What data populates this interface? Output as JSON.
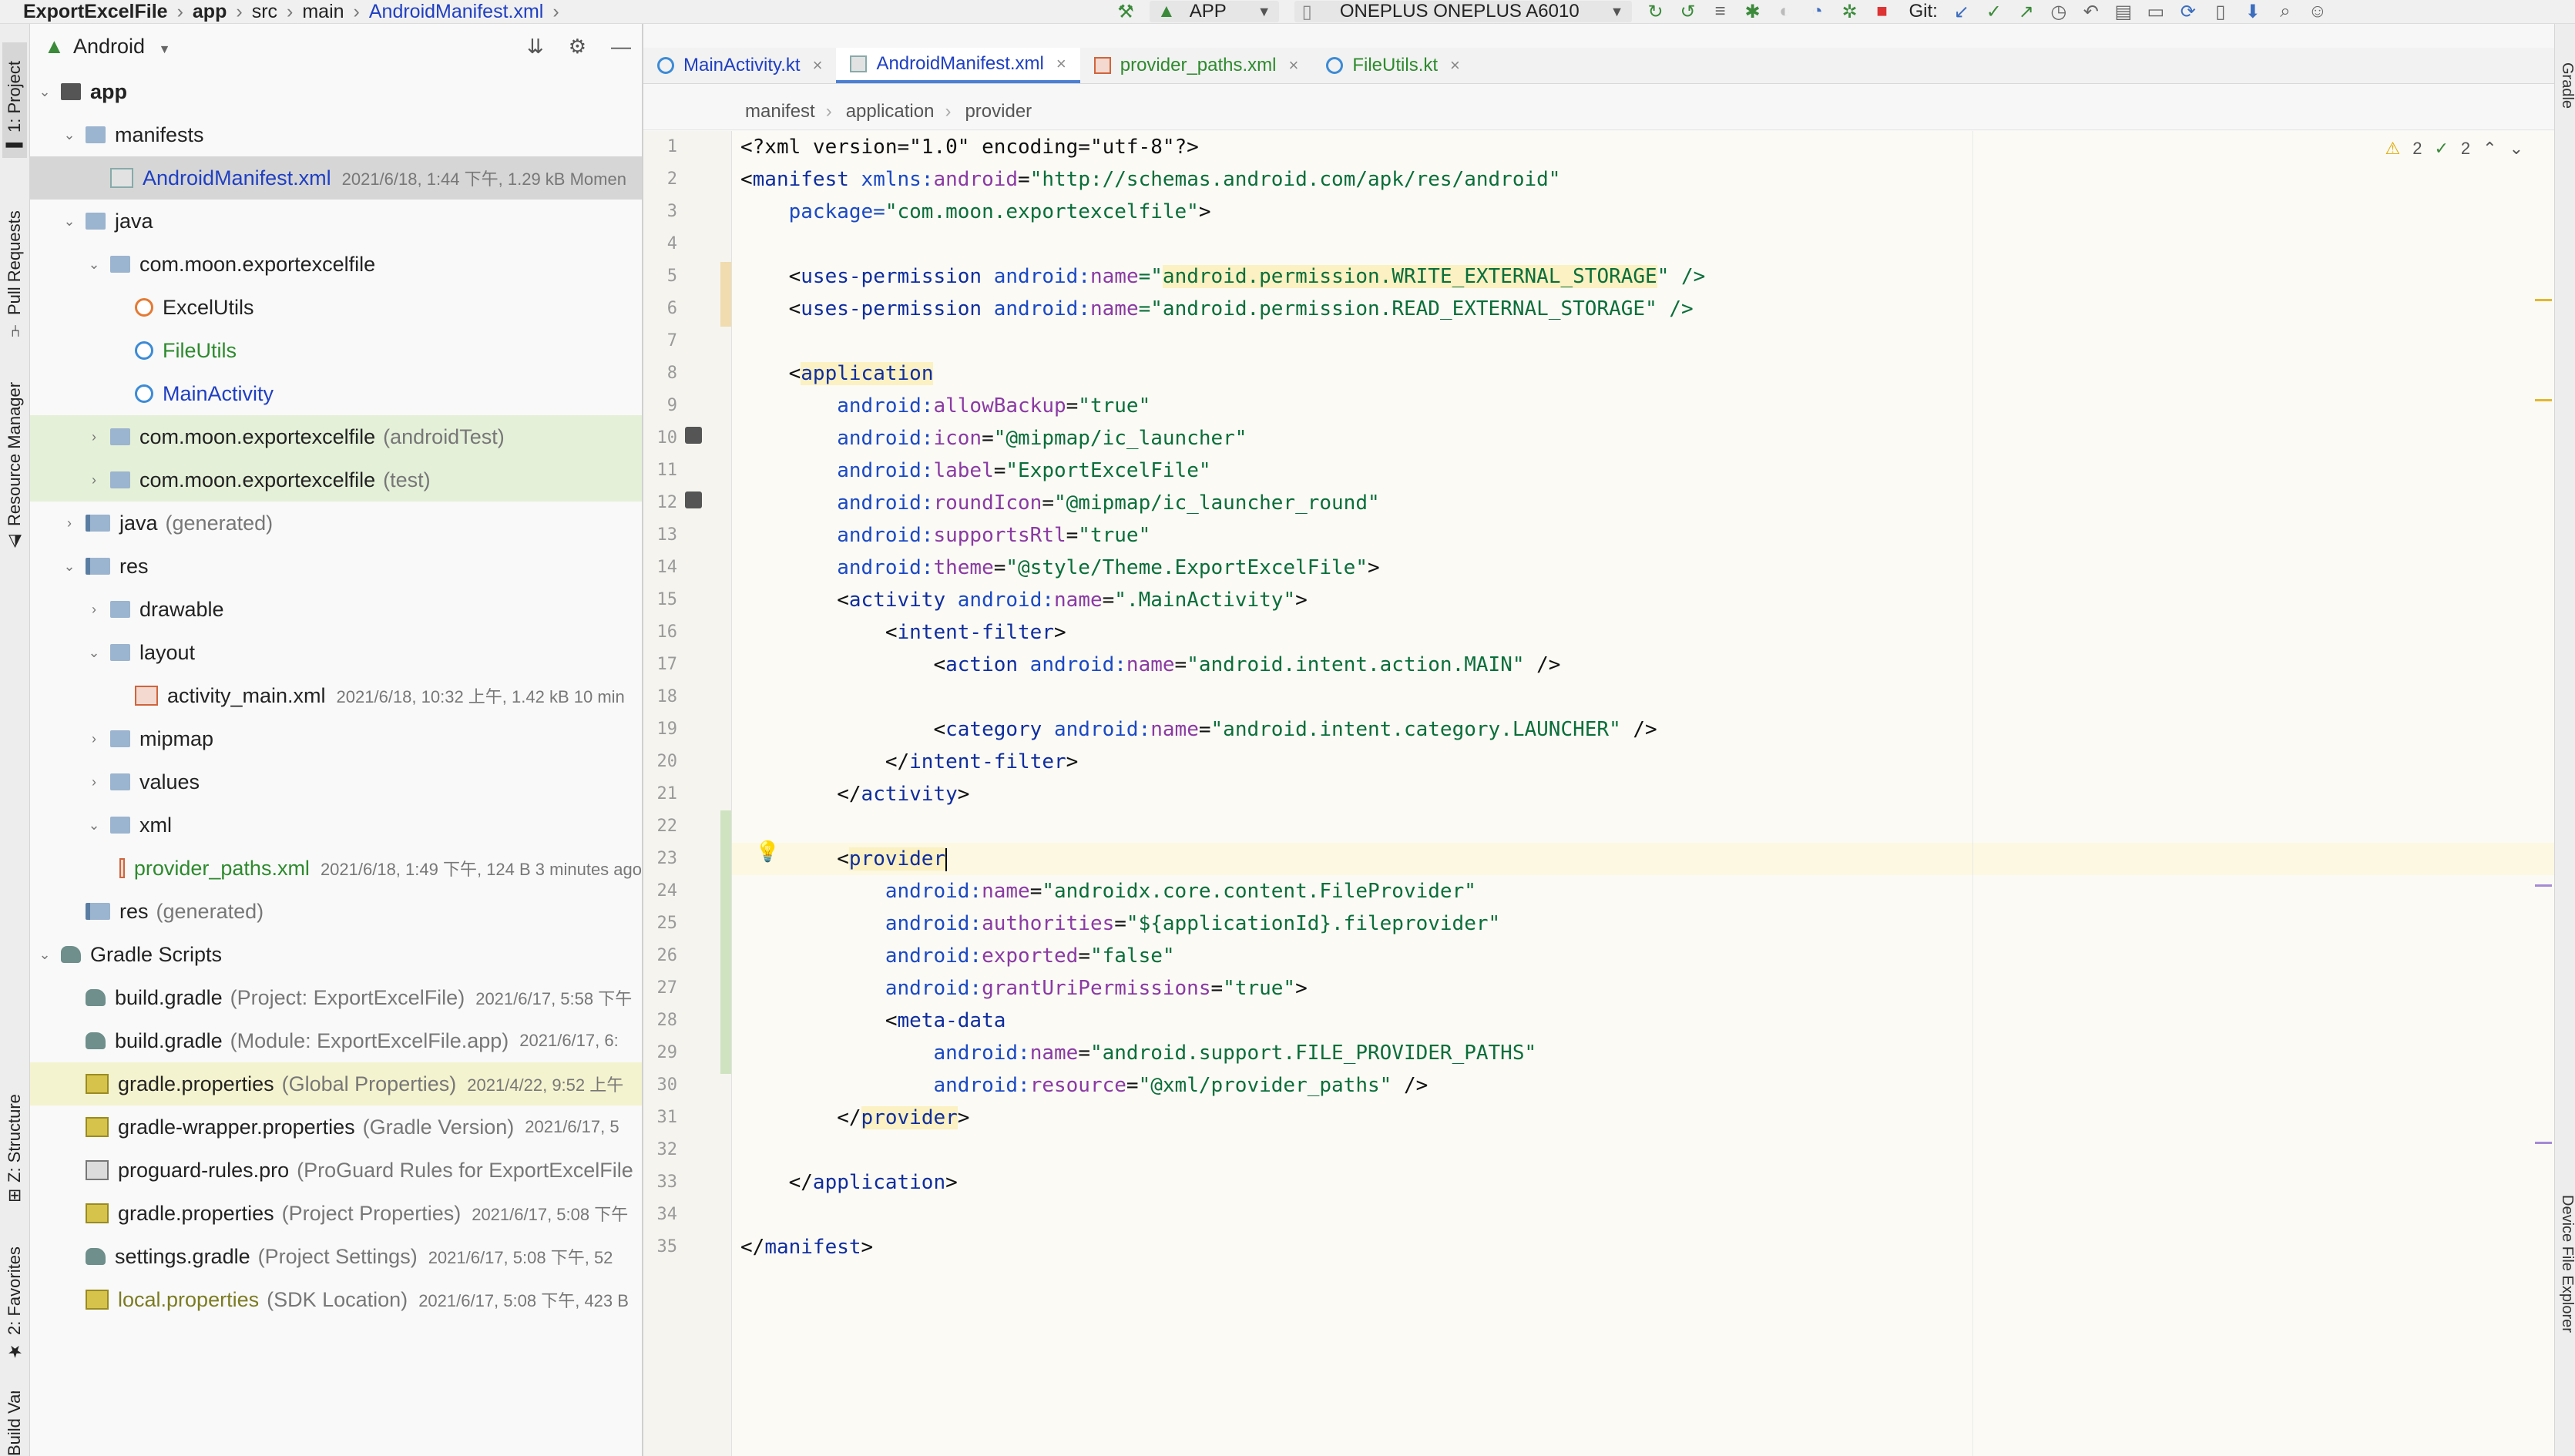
{
  "nav": {
    "breadcrumb": [
      "ExportExcelFile",
      "app",
      "src",
      "main",
      "AndroidManifest.xml"
    ],
    "run_config": "APP",
    "device": "ONEPLUS ONEPLUS A6010",
    "git_label": "Git:"
  },
  "left_tools": {
    "project": "1: Project",
    "pull_requests": "Pull Requests",
    "resource_manager": "Resource Manager",
    "structure": "Z: Structure",
    "favorites": "2: Favorites",
    "build_variants": "Build Variants"
  },
  "project_panel": {
    "view_mode": "Android",
    "tree": [
      {
        "label": "app",
        "bold": true
      },
      {
        "label": "manifests"
      },
      {
        "label": "AndroidManifest.xml",
        "meta": "2021/6/18, 1:44 下午, 1.29 kB Momen"
      },
      {
        "label": "java"
      },
      {
        "label": "com.moon.exportexcelfile"
      },
      {
        "label": "ExcelUtils"
      },
      {
        "label": "FileUtils"
      },
      {
        "label": "MainActivity"
      },
      {
        "label": "com.moon.exportexcelfile",
        "suffix": "(androidTest)"
      },
      {
        "label": "com.moon.exportexcelfile",
        "suffix": "(test)"
      },
      {
        "label": "java",
        "suffix": "(generated)"
      },
      {
        "label": "res"
      },
      {
        "label": "drawable"
      },
      {
        "label": "layout"
      },
      {
        "label": "activity_main.xml",
        "meta": "2021/6/18, 10:32 上午, 1.42 kB 10 min"
      },
      {
        "label": "mipmap"
      },
      {
        "label": "values"
      },
      {
        "label": "xml"
      },
      {
        "label": "provider_paths.xml",
        "meta": "2021/6/18, 1:49 下午, 124 B 3 minutes ago"
      },
      {
        "label": "res",
        "suffix": "(generated)"
      },
      {
        "label": "Gradle Scripts"
      },
      {
        "label": "build.gradle",
        "suffix": "(Project: ExportExcelFile)",
        "meta": "2021/6/17, 5:58 下午"
      },
      {
        "label": "build.gradle",
        "suffix": "(Module: ExportExcelFile.app)",
        "meta": "2021/6/17, 6:"
      },
      {
        "label": "gradle.properties",
        "suffix": "(Global Properties)",
        "meta": "2021/4/22, 9:52 上午"
      },
      {
        "label": "gradle-wrapper.properties",
        "suffix": "(Gradle Version)",
        "meta": "2021/6/17, 5"
      },
      {
        "label": "proguard-rules.pro",
        "suffix": "(ProGuard Rules for ExportExcelFile"
      },
      {
        "label": "gradle.properties",
        "suffix": "(Project Properties)",
        "meta": "2021/6/17, 5:08 下午"
      },
      {
        "label": "settings.gradle",
        "suffix": "(Project Settings)",
        "meta": "2021/6/17, 5:08 下午, 52"
      },
      {
        "label": "local.properties",
        "suffix": "(SDK Location)",
        "meta": "2021/6/17, 5:08 下午, 423 B"
      }
    ]
  },
  "editor": {
    "tabs": [
      "MainActivity.kt",
      "AndroidManifest.xml",
      "provider_paths.xml",
      "FileUtils.kt"
    ],
    "active_tab": "AndroidManifest.xml",
    "breadcrumb": [
      "manifest",
      "application",
      "provider"
    ],
    "inspection": {
      "warnings": "2",
      "ok": "2"
    },
    "line_numbers": [
      "1",
      "2",
      "3",
      "4",
      "5",
      "6",
      "7",
      "8",
      "9",
      "10",
      "11",
      "12",
      "13",
      "14",
      "15",
      "16",
      "17",
      "18",
      "19",
      "20",
      "21",
      "22",
      "23",
      "24",
      "25",
      "26",
      "27",
      "28",
      "29",
      "30",
      "31",
      "32",
      "33",
      "34",
      "35"
    ],
    "code": {
      "l1": {
        "a": "<?xml version=\"1.0\" encoding=\"utf-8\"?>"
      },
      "l2": {
        "a": "<",
        "b": "manifest",
        "c": " xmlns:",
        "d": "android",
        "e": "=",
        "f": "\"http://schemas.android.com/apk/res/android\""
      },
      "l3": {
        "a": "    package=",
        "b": "\"com.moon.exportexcelfile\"",
        "c": ">"
      },
      "l5": {
        "a": "    <",
        "b": "uses-permission",
        "c": " android:",
        "d": "name",
        "e": "=\"",
        "f": "android.permission.WRITE_EXTERNAL_STORAGE",
        "g": "\" />"
      },
      "l6": {
        "a": "    <",
        "b": "uses-permission",
        "c": " android:",
        "d": "name",
        "e": "=\"",
        "f": "android.permission.READ_EXTERNAL_STORAGE",
        "g": "\" />"
      },
      "l8": {
        "a": "    <",
        "b": "application"
      },
      "l9": {
        "a": "        android:",
        "b": "allowBackup",
        "c": "=",
        "d": "\"true\""
      },
      "l10": {
        "a": "        android:",
        "b": "icon",
        "c": "=",
        "d": "\"@mipmap/ic_launcher\""
      },
      "l11": {
        "a": "        android:",
        "b": "label",
        "c": "=",
        "d": "\"ExportExcelFile\""
      },
      "l12": {
        "a": "        android:",
        "b": "roundIcon",
        "c": "=",
        "d": "\"@mipmap/ic_launcher_round\""
      },
      "l13": {
        "a": "        android:",
        "b": "supportsRtl",
        "c": "=",
        "d": "\"true\""
      },
      "l14": {
        "a": "        android:",
        "b": "theme",
        "c": "=",
        "d": "\"@style/Theme.ExportExcelFile\"",
        "e": ">"
      },
      "l15": {
        "a": "        <",
        "b": "activity",
        "c": " android:",
        "d": "name",
        "e": "=",
        "f": "\".MainActivity\"",
        "g": ">"
      },
      "l16": {
        "a": "            <",
        "b": "intent-filter",
        "c": ">"
      },
      "l17": {
        "a": "                <",
        "b": "action",
        "c": " android:",
        "d": "name",
        "e": "=",
        "f": "\"android.intent.action.MAIN\"",
        "g": " />"
      },
      "l19": {
        "a": "                <",
        "b": "category",
        "c": " android:",
        "d": "name",
        "e": "=",
        "f": "\"android.intent.category.LAUNCHER\"",
        "g": " />"
      },
      "l20": {
        "a": "            </",
        "b": "intent-filter",
        "c": ">"
      },
      "l21": {
        "a": "        </",
        "b": "activity",
        "c": ">"
      },
      "l23": {
        "a": "        <",
        "b": "provider"
      },
      "l24": {
        "a": "            android:",
        "b": "name",
        "c": "=",
        "d": "\"androidx.core.content.FileProvider\""
      },
      "l25": {
        "a": "            android:",
        "b": "authorities",
        "c": "=",
        "d": "\"${applicationId}.fileprovider\""
      },
      "l26": {
        "a": "            android:",
        "b": "exported",
        "c": "=",
        "d": "\"false\""
      },
      "l27": {
        "a": "            android:",
        "b": "grantUriPermissions",
        "c": "=",
        "d": "\"true\"",
        "e": ">"
      },
      "l28": {
        "a": "            <",
        "b": "meta-data"
      },
      "l29": {
        "a": "                android:",
        "b": "name",
        "c": "=",
        "d": "\"android.support.FILE_PROVIDER_PATHS\""
      },
      "l30": {
        "a": "                android:",
        "b": "resource",
        "c": "=",
        "d": "\"@xml/provider_paths\"",
        "e": " />"
      },
      "l31": {
        "a": "        </",
        "b": "provider",
        "c": ">"
      },
      "l33": {
        "a": "    </",
        "b": "application",
        "c": ">"
      },
      "l35": {
        "a": "</",
        "b": "manifest",
        "c": ">"
      }
    }
  },
  "right_tools": {
    "gradle": "Gradle",
    "device_file_explorer": "Device File Explorer"
  },
  "colors": {
    "link_blue": "#1f3fc2",
    "tag_blue": "#0f2d9e",
    "value_green": "#0a6e3a",
    "vcs_added_green": "#e4f0d8",
    "highlight_yellow": "#fbf1c2"
  }
}
